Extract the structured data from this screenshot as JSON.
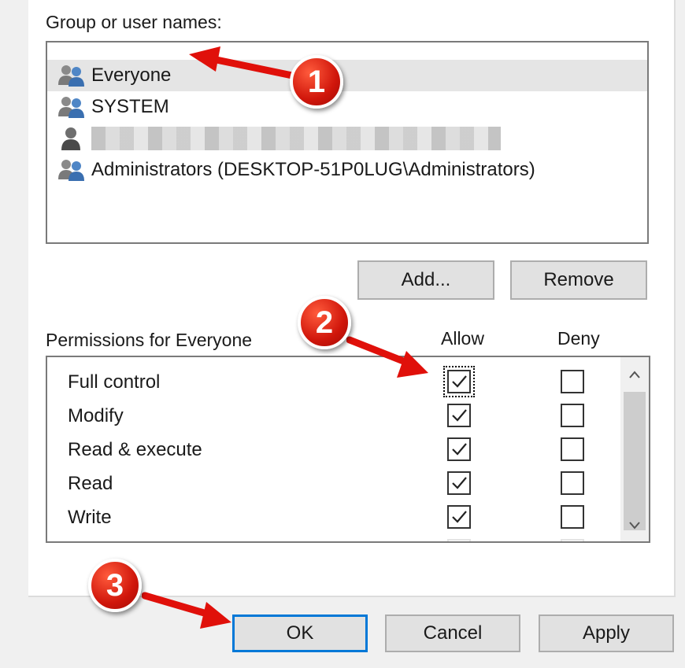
{
  "group_section": {
    "label": "Group or user names:",
    "users": [
      {
        "name": "Everyone",
        "icon": "group-icon",
        "selected": true
      },
      {
        "name": "SYSTEM",
        "icon": "group-icon",
        "selected": false
      },
      {
        "name": "",
        "icon": "user-icon",
        "selected": false,
        "redacted": true
      },
      {
        "name": "Administrators (DESKTOP-51P0LUG\\Administrators)",
        "icon": "group-icon",
        "selected": false
      }
    ],
    "add_label": "Add...",
    "remove_label": "Remove"
  },
  "permissions": {
    "label": "Permissions for Everyone",
    "allow_header": "Allow",
    "deny_header": "Deny",
    "rows": [
      {
        "name": "Full control",
        "allow": true,
        "deny": false
      },
      {
        "name": "Modify",
        "allow": true,
        "deny": false
      },
      {
        "name": "Read & execute",
        "allow": true,
        "deny": false
      },
      {
        "name": "Read",
        "allow": true,
        "deny": false
      },
      {
        "name": "Write",
        "allow": true,
        "deny": false
      }
    ]
  },
  "footer": {
    "ok_label": "OK",
    "cancel_label": "Cancel",
    "apply_label": "Apply"
  },
  "annotations": {
    "step1": "1",
    "step2": "2",
    "step3": "3",
    "badge_color": "#d0160b",
    "arrow_color": "#e0100a"
  },
  "colors": {
    "focus_border": "#0078d7",
    "selection": "#e5e5e5"
  }
}
